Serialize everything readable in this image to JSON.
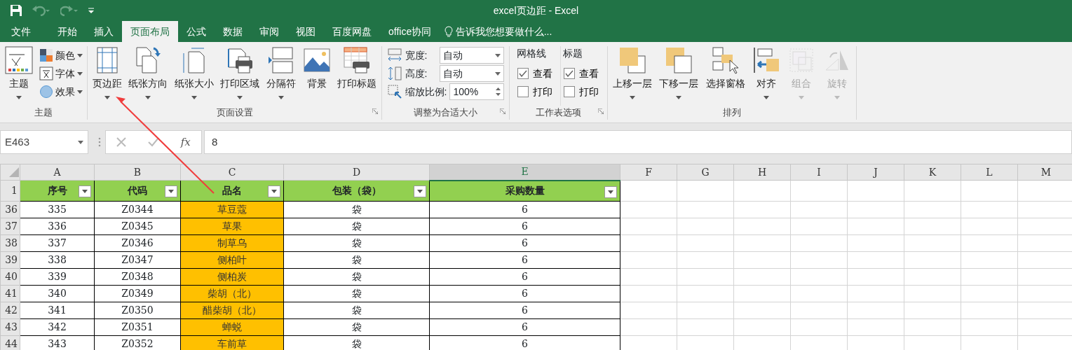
{
  "title_bar": {
    "title": "excel页边距 - Excel"
  },
  "tabs": [
    {
      "label": "文件",
      "selected": false
    },
    {
      "label": "开始",
      "selected": false
    },
    {
      "label": "插入",
      "selected": false
    },
    {
      "label": "页面布局",
      "selected": true
    },
    {
      "label": "公式",
      "selected": false
    },
    {
      "label": "数据",
      "selected": false
    },
    {
      "label": "审阅",
      "selected": false
    },
    {
      "label": "视图",
      "selected": false
    },
    {
      "label": "百度网盘",
      "selected": false
    },
    {
      "label": "office协同",
      "selected": false
    }
  ],
  "tell_me": "告诉我您想要做什么...",
  "ribbon": {
    "groups": [
      {
        "kind": "buttons",
        "title": "主题",
        "launcher": false,
        "items": [
          {
            "label": "主题",
            "dropdown": true,
            "disabled": false
          }
        ],
        "small_items": [
          {
            "label": "颜色",
            "dropdown": true
          },
          {
            "label": "字体",
            "dropdown": true
          },
          {
            "label": "效果",
            "dropdown": true
          }
        ]
      },
      {
        "kind": "buttons",
        "title": "页面设置",
        "launcher": true,
        "items": [
          {
            "label": "页边距",
            "dropdown": true,
            "disabled": false
          },
          {
            "label": "纸张方向",
            "dropdown": true,
            "disabled": false
          },
          {
            "label": "纸张大小",
            "dropdown": true,
            "disabled": false
          },
          {
            "label": "打印区域",
            "dropdown": true,
            "disabled": false
          },
          {
            "label": "分隔符",
            "dropdown": true,
            "disabled": false
          },
          {
            "label": "背景",
            "dropdown": false,
            "disabled": false
          },
          {
            "label": "打印标题",
            "dropdown": false,
            "disabled": false
          }
        ]
      },
      {
        "kind": "fields",
        "title": "调整为合适大小",
        "launcher": true,
        "fields": [
          {
            "kind": "select",
            "label": "宽度:",
            "value": "自动"
          },
          {
            "kind": "select",
            "label": "高度:",
            "value": "自动"
          },
          {
            "kind": "spin",
            "label": "缩放比例:",
            "value": "100%"
          }
        ]
      },
      {
        "kind": "options",
        "title": "工作表选项",
        "launcher": true,
        "columns": [
          {
            "heading": "网格线",
            "options": [
              {
                "label": "查看",
                "checked": true
              },
              {
                "label": "打印",
                "checked": false
              }
            ]
          },
          {
            "heading": "标题",
            "options": [
              {
                "label": "查看",
                "checked": true
              },
              {
                "label": "打印",
                "checked": false
              }
            ]
          }
        ]
      },
      {
        "kind": "buttons",
        "title": "排列",
        "launcher": false,
        "items": [
          {
            "label": "上移一层",
            "dropdown": true,
            "disabled": false
          },
          {
            "label": "下移一层",
            "dropdown": true,
            "disabled": false
          },
          {
            "label": "选择窗格",
            "dropdown": false,
            "disabled": false
          },
          {
            "label": "对齐",
            "dropdown": true,
            "disabled": false
          },
          {
            "label": "组合",
            "dropdown": true,
            "disabled": true
          },
          {
            "label": "旋转",
            "dropdown": true,
            "disabled": true
          }
        ]
      }
    ]
  },
  "formula_bar": {
    "name_box": "E463",
    "function_label": "fx",
    "formula": "8"
  },
  "sheet": {
    "columns": [
      {
        "label": "A",
        "selected": false
      },
      {
        "label": "B",
        "selected": false
      },
      {
        "label": "C",
        "selected": false
      },
      {
        "label": "D",
        "selected": false
      },
      {
        "label": "E",
        "selected": true
      },
      {
        "label": "F",
        "selected": false
      },
      {
        "label": "G",
        "selected": false
      },
      {
        "label": "H",
        "selected": false
      },
      {
        "label": "I",
        "selected": false
      },
      {
        "label": "J",
        "selected": false
      },
      {
        "label": "K",
        "selected": false
      },
      {
        "label": "L",
        "selected": false
      },
      {
        "label": "M",
        "selected": false
      }
    ],
    "header_row": {
      "row_number": "1",
      "cells": [
        {
          "text": "序号",
          "highlighted": false
        },
        {
          "text": "代码",
          "highlighted": false
        },
        {
          "text": "品名",
          "highlighted": true
        },
        {
          "text": "包装（袋）",
          "highlighted": false
        },
        {
          "text": "采购数量",
          "highlighted": false
        }
      ]
    },
    "rows": [
      {
        "row_number": "36",
        "cells": [
          "335",
          "Z0344",
          "草豆蔻",
          "袋",
          "6"
        ]
      },
      {
        "row_number": "37",
        "cells": [
          "336",
          "Z0345",
          "草果",
          "袋",
          "6"
        ]
      },
      {
        "row_number": "38",
        "cells": [
          "337",
          "Z0346",
          "制草乌",
          "袋",
          "6"
        ]
      },
      {
        "row_number": "39",
        "cells": [
          "338",
          "Z0347",
          "侧柏叶",
          "袋",
          "6"
        ]
      },
      {
        "row_number": "40",
        "cells": [
          "339",
          "Z0348",
          "侧柏炭",
          "袋",
          "6"
        ]
      },
      {
        "row_number": "41",
        "cells": [
          "340",
          "Z0349",
          "柴胡（北）",
          "袋",
          "6"
        ]
      },
      {
        "row_number": "42",
        "cells": [
          "341",
          "Z0350",
          "醋柴胡（北）",
          "袋",
          "6"
        ]
      },
      {
        "row_number": "43",
        "cells": [
          "342",
          "Z0351",
          "蝉蜕",
          "袋",
          "6"
        ]
      },
      {
        "row_number": "44",
        "cells": [
          "343",
          "Z0352",
          "车前草",
          "袋",
          "6"
        ]
      }
    ]
  }
}
